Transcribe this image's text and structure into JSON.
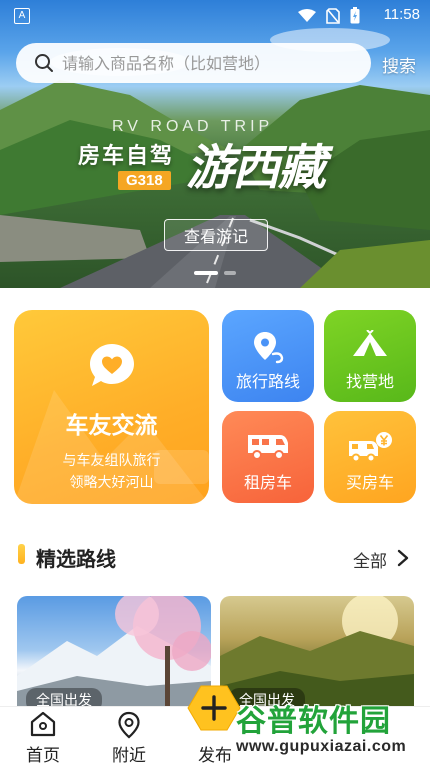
{
  "status_bar": {
    "app_glyph": "A",
    "time": "11:58"
  },
  "search": {
    "placeholder": "请输入商品名称（比如营地）",
    "button_label": "搜索"
  },
  "banner": {
    "subtitle": "RV ROAD TRIP",
    "title_left": "房车自驾",
    "route_badge": "G318",
    "title_right": "游西藏",
    "cta_label": "查看游记",
    "slide_count": 2,
    "active_slide": 1
  },
  "features": {
    "community": {
      "title": "车友交流",
      "desc_line1": "与车友组队旅行",
      "desc_line2": "领略大好河山",
      "icon": "heart-chat-icon"
    },
    "route": {
      "label": "旅行路线",
      "icon": "location-route-icon"
    },
    "camp": {
      "label": "找营地",
      "icon": "tent-icon"
    },
    "rent": {
      "label": "租房车",
      "icon": "rv-icon"
    },
    "buy": {
      "label": "买房车",
      "icon": "rv-yen-icon"
    }
  },
  "section": {
    "title": "精选路线",
    "more_label": "全部"
  },
  "route_cards": [
    {
      "tag": "全国出发"
    },
    {
      "tag": "全国出发"
    }
  ],
  "bottom_nav": {
    "items": [
      {
        "label": "首页",
        "icon": "home-icon"
      },
      {
        "label": "附近",
        "icon": "location-pin-icon"
      },
      {
        "label": "发布",
        "icon": "plus-icon"
      }
    ]
  },
  "watermark": {
    "name": "谷普软件园",
    "url": "www.gupuxiazai.com"
  },
  "colors": {
    "community": "#ffae28",
    "route": "#4a93f7",
    "camp": "#6cc71f",
    "rent": "#f9744a",
    "buy": "#ffb42e",
    "accent": "#ffc21f"
  }
}
